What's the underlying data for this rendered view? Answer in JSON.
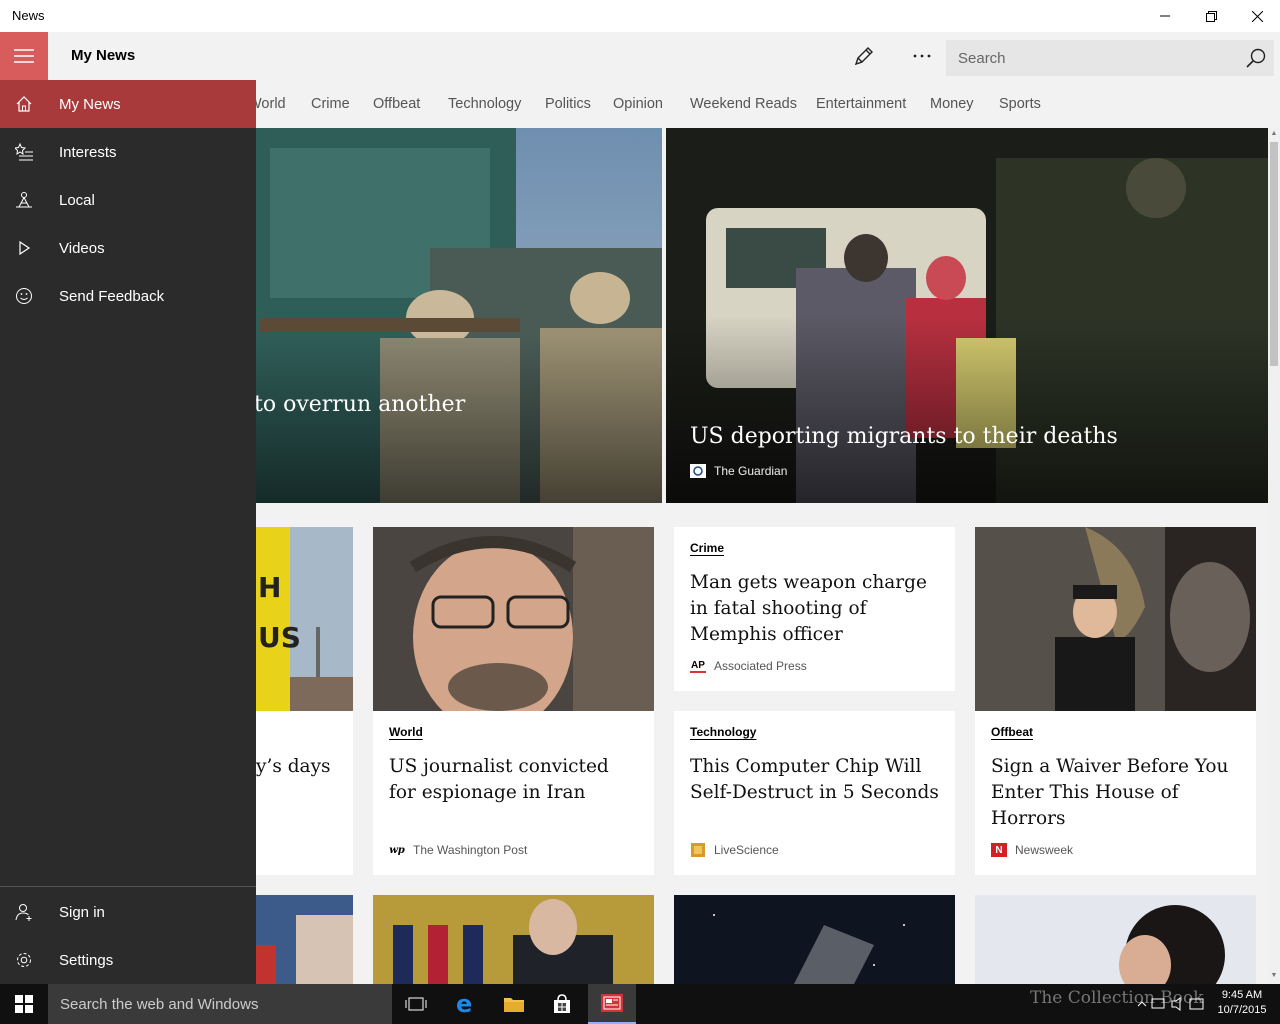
{
  "window": {
    "title": "News"
  },
  "header": {
    "page_title": "My News",
    "search_placeholder": "Search"
  },
  "tabs": [
    "World",
    "Crime",
    "Offbeat",
    "Technology",
    "Politics",
    "Opinion",
    "Weekend Reads",
    "Entertainment",
    "Money",
    "Sports"
  ],
  "nav": {
    "items": [
      {
        "label": "My News",
        "icon": "home-icon"
      },
      {
        "label": "Interests",
        "icon": "star-list-icon"
      },
      {
        "label": "Local",
        "icon": "local-icon"
      },
      {
        "label": "Videos",
        "icon": "play-icon"
      },
      {
        "label": "Send Feedback",
        "icon": "smiley-icon"
      }
    ],
    "bottom": [
      {
        "label": "Sign in",
        "icon": "person-icon"
      },
      {
        "label": "Settings",
        "icon": "gear-icon"
      }
    ]
  },
  "hero": [
    {
      "title": "to overrun another"
    },
    {
      "title": "US deporting migrants to their deaths",
      "source": "The Guardian"
    }
  ],
  "cards": [
    {
      "headline": "y’s days"
    },
    {
      "category": "World",
      "headline": "US journalist convicted for espionage in Iran",
      "source": "The Washington Post",
      "logo": "wp"
    },
    {
      "category": "Crime",
      "headline": "Man gets weapon charge in fatal shooting of Memphis officer",
      "source": "Associated Press",
      "logo": "AP"
    },
    {
      "category": "Technology",
      "headline": "This Computer Chip Will Self-Destruct in 5 Seconds",
      "source": "LiveScience"
    },
    {
      "category": "Offbeat",
      "headline": "Sign a Waiver Before You Enter This House of Horrors",
      "source": "Newsweek",
      "logo": "N"
    }
  ],
  "taskbar": {
    "search_text": "Search the web and Windows",
    "watermark": "The Collection Book",
    "time": "9:45 AM",
    "date": "10/7/2015"
  },
  "colors": {
    "accent": "#a83a3c",
    "hamburger": "#d95c5c",
    "nav_bg": "#2b2b2b"
  }
}
